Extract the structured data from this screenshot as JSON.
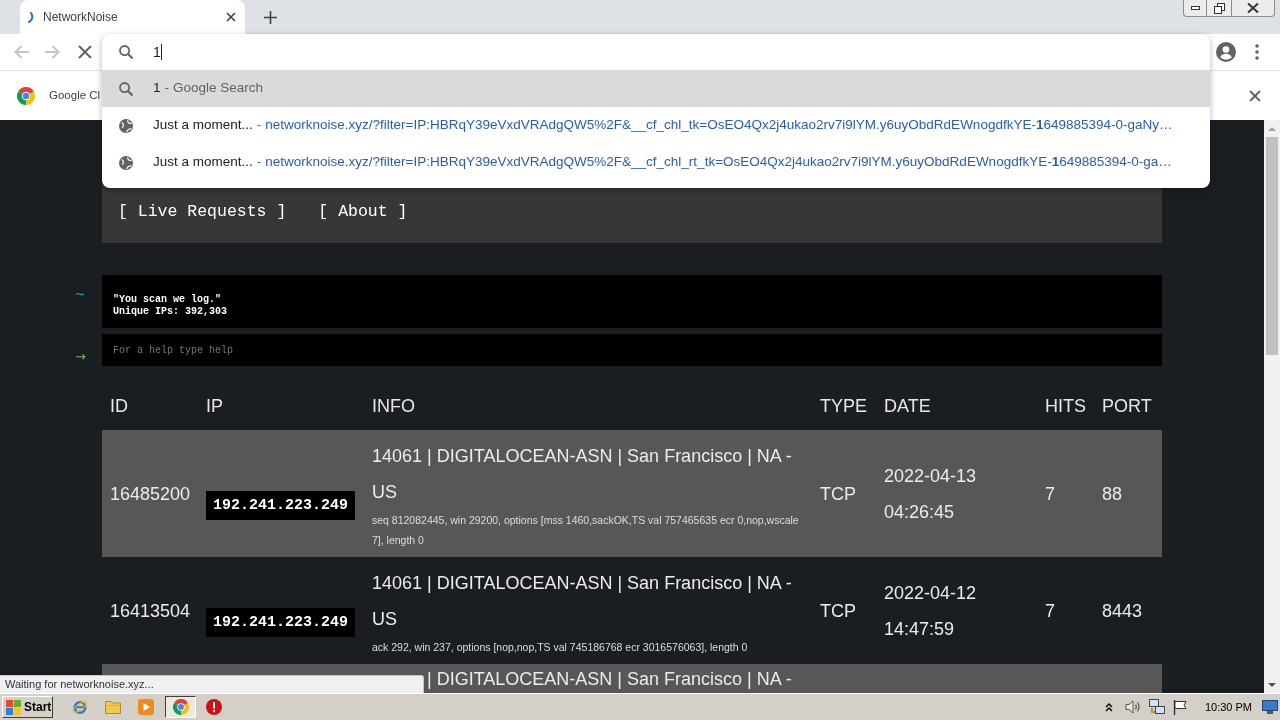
{
  "browser": {
    "tabs": [
      {
        "title": "NetworkNoise",
        "selected": true
      }
    ],
    "nav_buttons": [
      {
        "kind": "back",
        "disabled": true
      },
      {
        "kind": "forward",
        "disabled": true
      },
      {
        "kind": "stop",
        "disabled": false
      }
    ],
    "omnibox": {
      "value": "1",
      "suggestions": [
        {
          "kind": "search",
          "text": "1",
          "separator": "-",
          "description": "Google Search",
          "selected": true
        },
        {
          "kind": "history",
          "text": "Just a moment...",
          "separator": "-",
          "description": "networknoise.xyz/?filter=IP:HBRqY39eVxdVRAdgQW5%2F&__cf_chl_tk=OsEO4Qx2j4ukao2rv7i9lYM.y6uyObdRdEWnogdfkYE-**1**649885394-0-gaNy…",
          "selected": false
        },
        {
          "kind": "history",
          "text": "Just a moment...",
          "separator": "-",
          "description": "networknoise.xyz/?filter=IP:HBRqY39eVxdVRAdgQW5%2F&__cf_chl_rt_tk=OsEO4Qx2j4ukao2rv7i9lYM.y6uyObdRdEWnogdfkYE-**1**649885394-0-ga…",
          "selected": false
        }
      ]
    },
    "infobar": {
      "text": "Google Cl"
    },
    "status": "Waiting for networknoise.xyz..."
  },
  "page": {
    "nav": [
      "[ Live Requests ]",
      "[ About ]"
    ],
    "terminal": {
      "prompt": "~",
      "lines": [
        "\"You scan we log.\"",
        "Unique IPs: 392,303"
      ]
    },
    "command": {
      "prompt": "→",
      "placeholder": "For a help type help"
    },
    "table": {
      "columns": [
        "ID",
        "IP",
        "INFO",
        "TYPE",
        "DATE",
        "HITS",
        "PORT"
      ],
      "rows": [
        {
          "id": "16485200",
          "ip": "192.241.223.249",
          "info": "14061 | DIGITALOCEAN-ASN | San Francisco | NA - US",
          "detail": "seq 812082445, win 29200, options [mss 1460,sackOK,TS val 757465635 ecr 0,nop,wscale 7], length 0",
          "type": "TCP",
          "date": "2022-04-13 04:26:45",
          "hits": "7",
          "port": "88"
        },
        {
          "id": "16413504",
          "ip": "192.241.223.249",
          "info": "14061 | DIGITALOCEAN-ASN | San Francisco | NA - US",
          "detail": "ack 292, win 237, options [nop,nop,TS val 745186768 ecr 3016576063], length 0",
          "type": "TCP",
          "date": "2022-04-12 14:47:59",
          "hits": "7",
          "port": "8443"
        }
      ],
      "partial_row": {
        "info": "| DIGITALOCEAN-ASN | San Francisco | NA -"
      }
    }
  },
  "taskbar": {
    "start": "Start",
    "clock": "10:30 PM"
  }
}
